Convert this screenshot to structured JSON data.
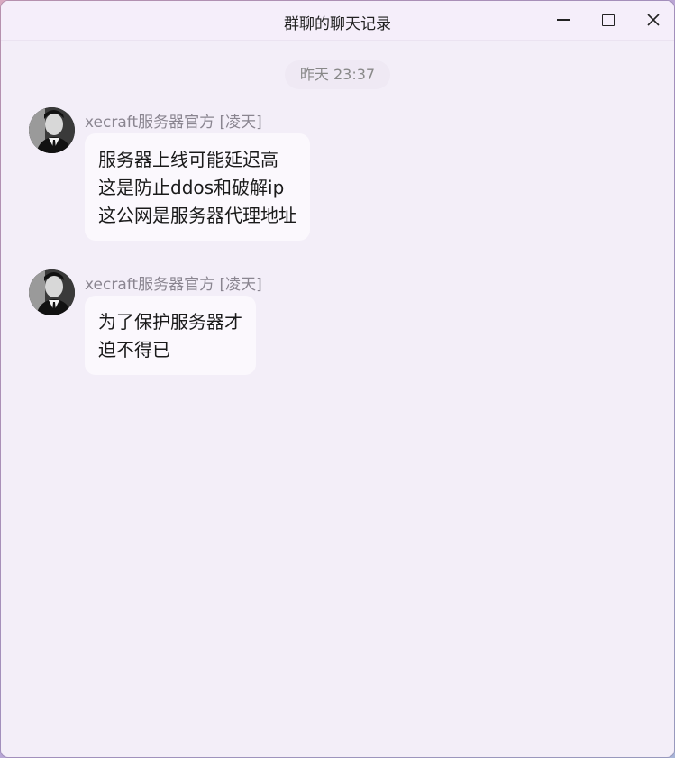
{
  "window": {
    "title": "群聊的聊天记录"
  },
  "controls": {
    "minimize": "minimize-icon",
    "maximize": "maximize-icon",
    "close": "close-icon"
  },
  "timestamp": "昨天 23:37",
  "messages": [
    {
      "sender": "xecraft服务器官方 [凌天]",
      "lines": [
        "服务器上线可能延迟高",
        "这是防止ddos和破解ip",
        "这公网是服务器代理地址"
      ]
    },
    {
      "sender": "xecraft服务器官方 [凌天]",
      "lines": [
        "为了保护服务器才",
        "迫不得已"
      ]
    }
  ]
}
